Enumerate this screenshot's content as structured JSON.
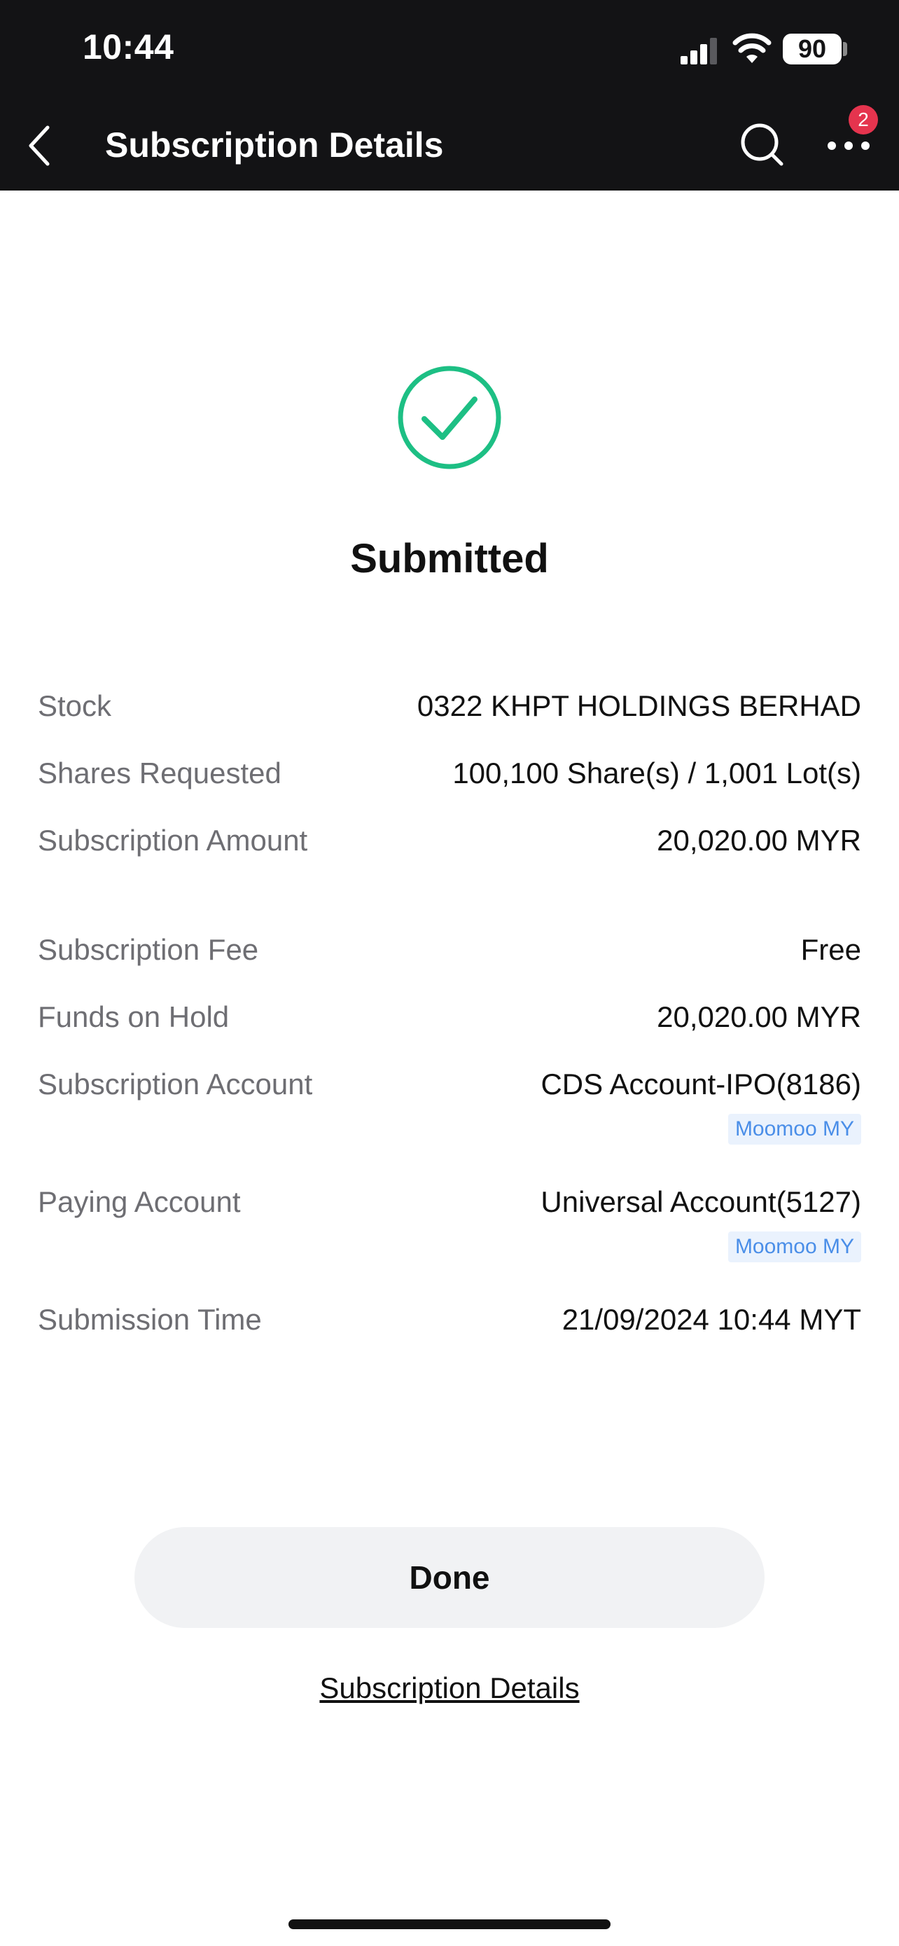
{
  "status_bar": {
    "time": "10:44",
    "battery": "90"
  },
  "nav": {
    "title": "Subscription Details",
    "badge_count": "2"
  },
  "result": {
    "title": "Submitted",
    "accent_color": "#1dbf84"
  },
  "details": {
    "stock": {
      "label": "Stock",
      "value": "0322 KHPT HOLDINGS BERHAD"
    },
    "shares": {
      "label": "Shares Requested",
      "value": "100,100 Share(s) / 1,001 Lot(s)"
    },
    "amount": {
      "label": "Subscription Amount",
      "value": "20,020.00 MYR"
    },
    "fee": {
      "label": "Subscription Fee",
      "value": "Free"
    },
    "hold": {
      "label": "Funds on Hold",
      "value": "20,020.00 MYR"
    },
    "sub_account": {
      "label": "Subscription Account",
      "value": "CDS Account-IPO(8186)",
      "tag": "Moomoo MY"
    },
    "pay_account": {
      "label": "Paying Account",
      "value": "Universal Account(5127)",
      "tag": "Moomoo MY"
    },
    "time": {
      "label": "Submission Time",
      "value": "21/09/2024 10:44 MYT"
    }
  },
  "actions": {
    "done_label": "Done",
    "details_link": "Subscription Details"
  }
}
